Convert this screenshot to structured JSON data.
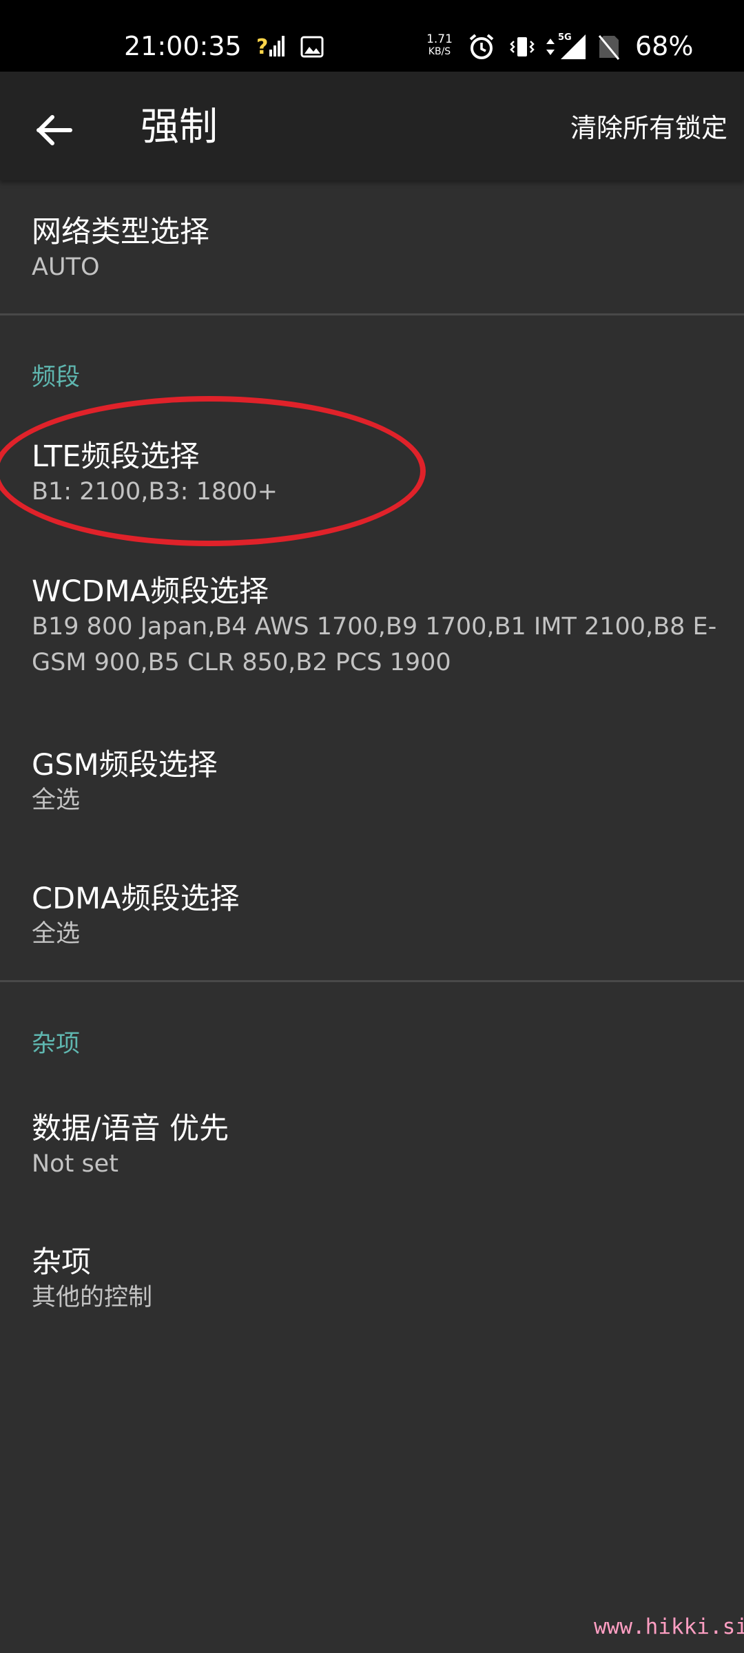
{
  "status_bar": {
    "time": "21:00:35",
    "net_speed_value": "1.71",
    "net_speed_unit": "KB/S",
    "network_label": "5G",
    "battery": "68%",
    "icons": [
      "signal-unknown-icon",
      "image-icon",
      "alarm-icon",
      "vibrate-icon",
      "data-arrows-icon",
      "signal-icon",
      "no-sim-icon"
    ]
  },
  "toolbar": {
    "title": "强制",
    "action": "清除所有锁定"
  },
  "items": {
    "network_type": {
      "title": "网络类型选择",
      "subtitle": "AUTO"
    },
    "lte": {
      "title": "LTE频段选择",
      "subtitle": "B1: 2100,B3: 1800+"
    },
    "wcdma": {
      "title": "WCDMA频段选择",
      "subtitle": "B19 800 Japan,B4 AWS 1700,B9 1700,B1 IMT 2100,B8 E-GSM 900,B5 CLR 850,B2 PCS 1900"
    },
    "gsm": {
      "title": "GSM频段选择",
      "subtitle": "全选"
    },
    "cdma": {
      "title": "CDMA频段选择",
      "subtitle": "全选"
    },
    "priority": {
      "title": "数据/语音 优先",
      "subtitle": "Not set"
    },
    "misc": {
      "title": "杂项",
      "subtitle": "其他的控制"
    }
  },
  "sections": {
    "band": "频段",
    "misc": "杂项"
  },
  "colors": {
    "background": "#2f2f2f",
    "toolbar": "#232323",
    "section_header": "#5fb7b0",
    "highlight": "#e0222a",
    "watermark": "#ff9fc3"
  },
  "watermark": "www.hikki.site"
}
